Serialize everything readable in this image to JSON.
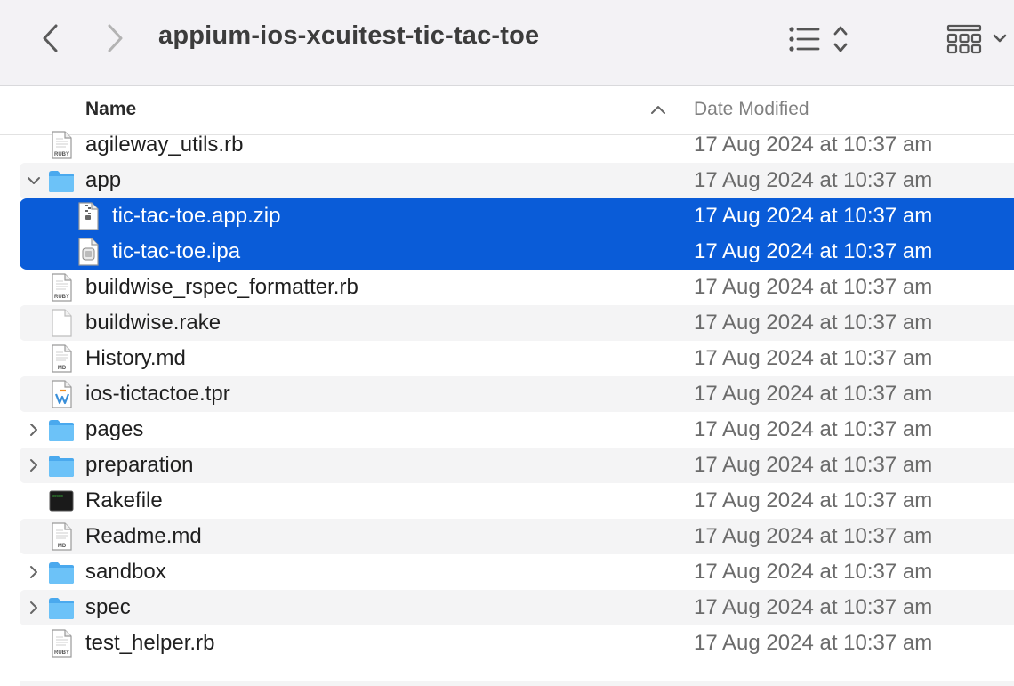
{
  "window": {
    "title": "appium-ios-xcuitest-tic-tac-toe"
  },
  "toolbar": {
    "back_icon": "chevron-left-icon",
    "forward_icon": "chevron-right-icon",
    "view_icon": "list-view-icon",
    "group_icon": "group-grid-icon"
  },
  "columns": {
    "name": "Name",
    "date_modified": "Date Modified",
    "sort_direction": "ascending"
  },
  "colors": {
    "selection": "#0a5cd8",
    "folder": "#5bb8f5",
    "alt_row": "#f4f4f5"
  },
  "files": [
    {
      "name": "agileway_utils.rb",
      "date": "17 Aug 2024 at 10:37 am",
      "icon": "ruby-file-icon",
      "level": 0
    },
    {
      "name": "app",
      "date": "17 Aug 2024 at 10:37 am",
      "icon": "folder-icon",
      "level": 0,
      "expanded": true
    },
    {
      "name": "tic-tac-toe.app.zip",
      "date": "17 Aug 2024 at 10:37 am",
      "icon": "zip-file-icon",
      "level": 1,
      "selected": true
    },
    {
      "name": "tic-tac-toe.ipa",
      "date": "17 Aug 2024 at 10:37 am",
      "icon": "ipa-file-icon",
      "level": 1,
      "selected": true
    },
    {
      "name": "buildwise_rspec_formatter.rb",
      "date": "17 Aug 2024 at 10:37 am",
      "icon": "ruby-file-icon",
      "level": 0
    },
    {
      "name": "buildwise.rake",
      "date": "17 Aug 2024 at 10:37 am",
      "icon": "blank-file-icon",
      "level": 0
    },
    {
      "name": "History.md",
      "date": "17 Aug 2024 at 10:37 am",
      "icon": "markdown-file-icon",
      "level": 0
    },
    {
      "name": "ios-tictactoe.tpr",
      "date": "17 Aug 2024 at 10:37 am",
      "icon": "testwise-project-icon",
      "level": 0
    },
    {
      "name": "pages",
      "date": "17 Aug 2024 at 10:37 am",
      "icon": "folder-icon",
      "level": 0,
      "expanded": false
    },
    {
      "name": "preparation",
      "date": "17 Aug 2024 at 10:37 am",
      "icon": "folder-icon",
      "level": 0,
      "expanded": false
    },
    {
      "name": "Rakefile",
      "date": "17 Aug 2024 at 10:37 am",
      "icon": "terminal-exec-icon",
      "level": 0
    },
    {
      "name": "Readme.md",
      "date": "17 Aug 2024 at 10:37 am",
      "icon": "markdown-file-icon",
      "level": 0
    },
    {
      "name": "sandbox",
      "date": "17 Aug 2024 at 10:37 am",
      "icon": "folder-icon",
      "level": 0,
      "expanded": false
    },
    {
      "name": "spec",
      "date": "17 Aug 2024 at 10:37 am",
      "icon": "folder-icon",
      "level": 0,
      "expanded": false
    },
    {
      "name": "test_helper.rb",
      "date": "17 Aug 2024 at 10:37 am",
      "icon": "ruby-file-icon",
      "level": 0
    }
  ]
}
